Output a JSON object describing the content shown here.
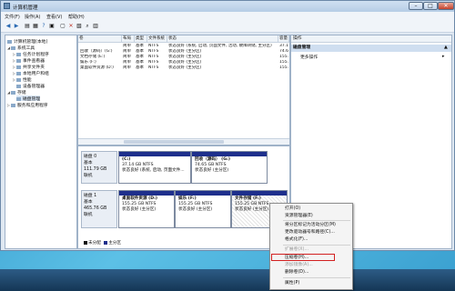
{
  "window": {
    "title": "计算机管理"
  },
  "menubar": [
    "文件(F)",
    "操作(A)",
    "查看(V)",
    "帮助(H)"
  ],
  "toolbar_icons": [
    "back-icon",
    "forward-icon",
    "up-icon",
    "properties-icon",
    "help-icon",
    "refresh-icon",
    "delete-icon",
    "open-icon",
    "search-icon",
    "view-icon",
    "export-icon"
  ],
  "nav": {
    "items": [
      {
        "label": "计算机管理(本地)",
        "level": 0,
        "expander": ""
      },
      {
        "label": "系统工具",
        "level": 1,
        "expander": "◢"
      },
      {
        "label": "任务计划程序",
        "level": 2,
        "expander": "▷"
      },
      {
        "label": "事件查看器",
        "level": 2,
        "expander": "▷"
      },
      {
        "label": "共享文件夹",
        "level": 2,
        "expander": "▷"
      },
      {
        "label": "本地用户和组",
        "level": 2,
        "expander": "▷"
      },
      {
        "label": "性能",
        "level": 2,
        "expander": "▷"
      },
      {
        "label": "设备管理器",
        "level": 2,
        "expander": ""
      },
      {
        "label": "存储",
        "level": 1,
        "expander": "◢"
      },
      {
        "label": "磁盘管理",
        "level": 2,
        "expander": ""
      },
      {
        "label": "服务和应用程序",
        "level": 1,
        "expander": "▷"
      }
    ]
  },
  "volumes": {
    "headers": [
      "卷",
      "布局",
      "类型",
      "文件系统",
      "状态",
      "容量"
    ],
    "rows": [
      [
        "",
        "简单",
        "基本",
        "NTFS",
        "状态良好 (系统, 启动, 页面文件, 活动, 故障转储, 主分区)",
        "37.1"
      ],
      [
        "回收（源码）(G:)",
        "简单",
        "基本",
        "NTFS",
        "状态良好 (主分区)",
        "74.6"
      ],
      [
        "文档存储 (E:)",
        "简单",
        "基本",
        "NTFS",
        "状态良好 (主分区)",
        "155."
      ],
      [
        "娱乐 (F:)",
        "简单",
        "基本",
        "NTFS",
        "状态良好 (主分区)",
        "155."
      ],
      [
        "桌面软件资源 (D:)",
        "简单",
        "基本",
        "NTFS",
        "状态良好 (主分区)",
        "155."
      ]
    ]
  },
  "disks": [
    {
      "name": "磁盘 0",
      "type": "基本",
      "size": "111.79 GB",
      "status": "联机",
      "partitions": [
        {
          "name": "(C:)",
          "size": "37.14 GB NTFS",
          "status": "状态良好 (系统, 启动, 页面文件...",
          "selected": false
        },
        {
          "name": "回收（源码） (G:)",
          "size": "74.65 GB NTFS",
          "status": "状态良好 (主分区)",
          "selected": false
        }
      ]
    },
    {
      "name": "磁盘 1",
      "type": "基本",
      "size": "465.76 GB",
      "status": "联机",
      "partitions": [
        {
          "name": "桌面软件资源 (D:)",
          "size": "155.25 GB NTFS",
          "status": "状态良好 (主分区)",
          "selected": false
        },
        {
          "name": "娱乐 (F:)",
          "size": "155.25 GB NTFS",
          "status": "状态良好 (主分区)",
          "selected": false
        },
        {
          "name": "文件存储 (F:)",
          "size": "155.25 GB NTFS",
          "status": "状态良好 (主分区)",
          "selected": true
        }
      ]
    }
  ],
  "legend": {
    "unallocated": "未分配",
    "primary": "主分区"
  },
  "actions": {
    "header": "操作",
    "section": "磁盘管理",
    "more": "更多操作"
  },
  "context_menu": {
    "items": [
      {
        "label": "打开(O)",
        "disabled": false
      },
      {
        "label": "资源管理器(E)",
        "disabled": false
      },
      {
        "label": "",
        "separator": true
      },
      {
        "label": "将分区标记为活动分区(M)",
        "disabled": false
      },
      {
        "label": "更改驱动器号和路径(C)...",
        "disabled": false
      },
      {
        "label": "格式化(F)...",
        "disabled": false
      },
      {
        "label": "",
        "separator": true
      },
      {
        "label": "扩展卷(X)...",
        "disabled": true
      },
      {
        "label": "压缩卷(H)...",
        "disabled": false,
        "highlighted": true
      },
      {
        "label": "添加镜像(A)...",
        "disabled": true
      },
      {
        "label": "删除卷(D)...",
        "disabled": false
      },
      {
        "label": "",
        "separator": true
      },
      {
        "label": "属性(P)",
        "disabled": false
      }
    ]
  }
}
